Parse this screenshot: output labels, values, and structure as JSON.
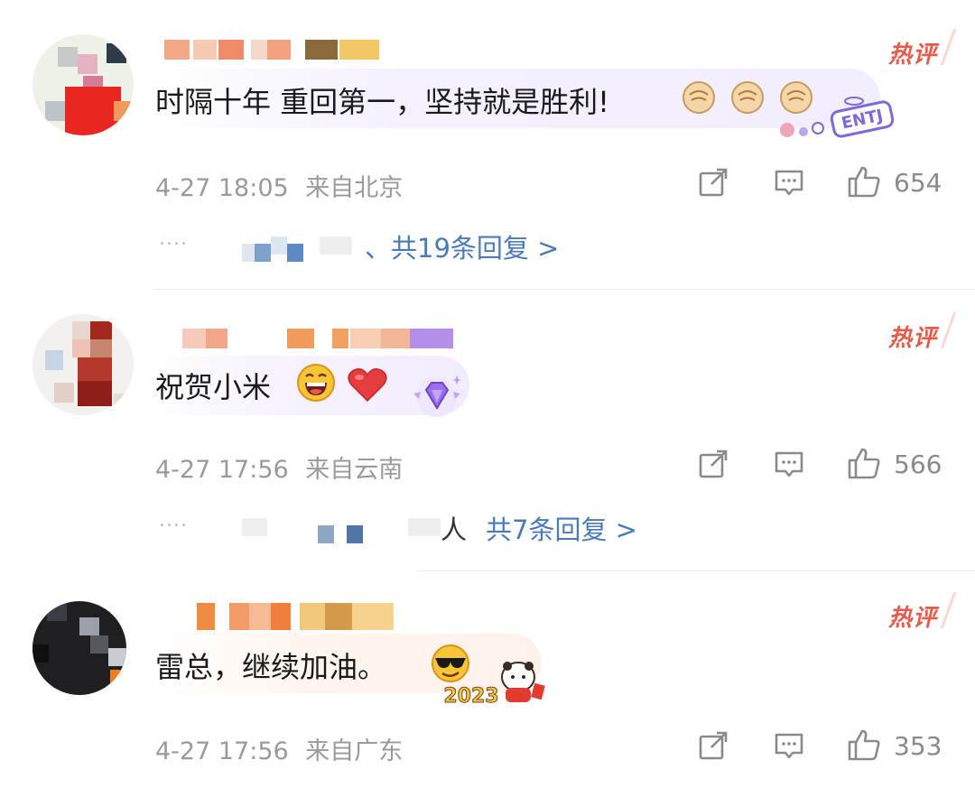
{
  "comments": [
    {
      "hot_label": "热评",
      "text": "时隔十年 重回第一，坚持就是胜利!",
      "emoji_icons": [
        "fist-icon",
        "fist-icon",
        "fist-icon"
      ],
      "sticker": "ENTJ",
      "date": "4-27 18:05",
      "location": "来自北京",
      "likes": "654",
      "reply_link": "、共19条回复 >"
    },
    {
      "hot_label": "热评",
      "text": "祝贺小米",
      "emoji_icons": [
        "grin-face-icon",
        "red-heart-icon"
      ],
      "sticker": "diamond-badge",
      "date": "4-27 17:56",
      "location": "来自云南",
      "likes": "566",
      "reply_suffix": "人",
      "reply_link": "共7条回复 >"
    },
    {
      "hot_label": "热评",
      "text": "雷总，继续加油。",
      "emoji_icons": [
        "sunglasses-face-icon"
      ],
      "sticker": "2023",
      "date": "4-27 17:56",
      "location": "来自广东",
      "likes": "353"
    }
  ],
  "dots": "....",
  "colors": {
    "hot": "#e85a4a",
    "link": "#4b7ab8",
    "meta": "#9a9a9a"
  }
}
